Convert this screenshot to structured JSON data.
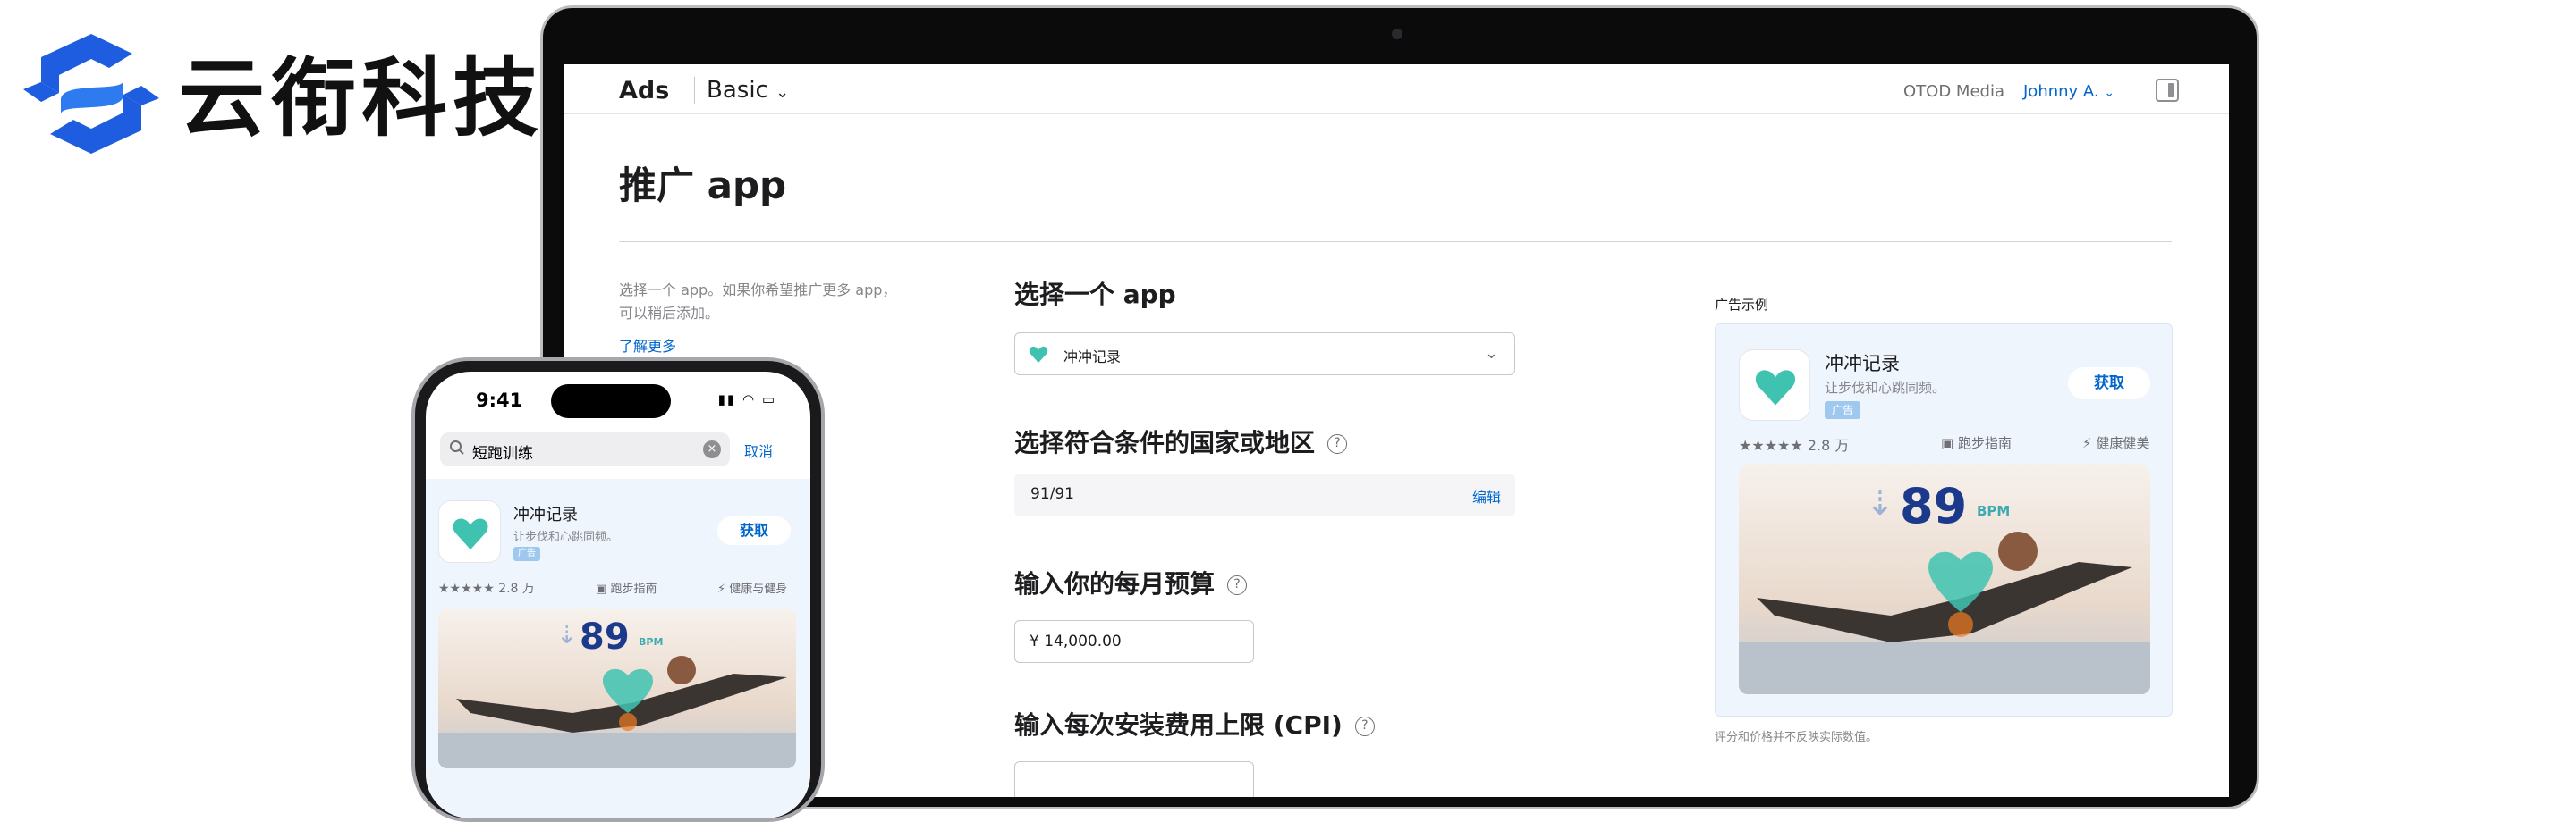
{
  "brand": {
    "name": "云衔科技",
    "logo_icon": "s-swirl-icon",
    "color": "#1e5de0"
  },
  "laptop": {
    "topbar": {
      "ads_label": "Ads",
      "plan": "Basic",
      "org": "OTOD Media",
      "user": "Johnny A."
    },
    "page_title": "推广 app",
    "help_text": "选择一个 app。如果你希望推广更多 app，可以稍后添加。",
    "learn_more": "了解更多",
    "sections": {
      "select_app": {
        "label": "选择一个 app",
        "value": "冲冲记录"
      },
      "countries": {
        "label": "选择符合条件的国家或地区",
        "value": "91/91",
        "edit": "编辑"
      },
      "budget": {
        "label": "输入你的每月预算",
        "value": "¥ 14,000.00"
      },
      "cpi": {
        "label": "输入每次安装费用上限 (CPI)",
        "value": ""
      }
    },
    "preview": {
      "label": "广告示例",
      "app_name": "冲冲记录",
      "subtitle": "让步伐和心跳同频。",
      "ad_badge": "广告",
      "get": "获取",
      "rating": "★★★★★ 2.8 万",
      "category1": "跑步指南",
      "category2": "健康健美",
      "bpm_value": "89",
      "bpm_unit": "BPM",
      "note": "评分和价格并不反映实际数值。"
    }
  },
  "phone": {
    "time": "9:41",
    "search_query": "短跑训练",
    "cancel": "取消",
    "app_name": "冲冲记录",
    "subtitle": "让步伐和心跳同频。",
    "ad_badge": "广告",
    "get": "获取",
    "rating": "★★★★★ 2.8 万",
    "category1": "跑步指南",
    "category2": "健康与健身",
    "bpm_value": "89",
    "bpm_unit": "BPM"
  }
}
